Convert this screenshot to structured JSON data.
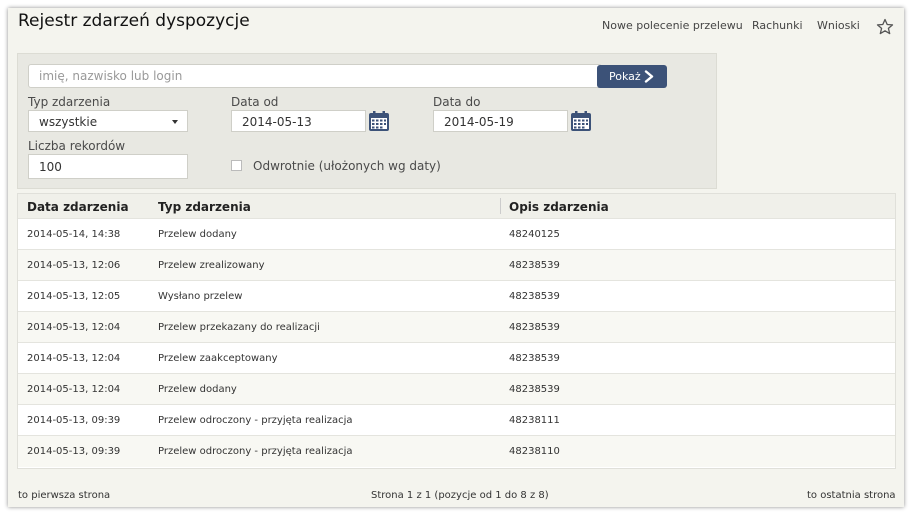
{
  "page": {
    "title": "Rejestr zdarzeń dyspozycje"
  },
  "topnav": {
    "items": [
      {
        "label": "Nowe polecenie przelewu"
      },
      {
        "label": "Rachunki"
      },
      {
        "label": "Wnioski"
      }
    ],
    "favorite_icon": "star-icon"
  },
  "filters": {
    "search_placeholder": "imię, nazwisko lub login",
    "show_button": "Pokaż",
    "event_type_label": "Typ zdarzenia",
    "event_type_value": "wszystkie",
    "date_from_label": "Data od",
    "date_from_value": "2014-05-13",
    "date_to_label": "Data do",
    "date_to_value": "2014-05-19",
    "record_count_label": "Liczba rekordów",
    "record_count_value": "100",
    "reverse_label": "Odwrotnie (ułożonych wg daty)",
    "reverse_checked": false
  },
  "table": {
    "headers": [
      "Data zdarzenia",
      "Typ zdarzenia",
      "Opis zdarzenia"
    ],
    "rows": [
      [
        "2014-05-14, 14:38",
        "Przelew dodany",
        "48240125"
      ],
      [
        "2014-05-13, 12:06",
        "Przelew zrealizowany",
        "48238539"
      ],
      [
        "2014-05-13, 12:05",
        "Wysłano przelew",
        "48238539"
      ],
      [
        "2014-05-13, 12:04",
        "Przelew przekazany do realizacji",
        "48238539"
      ],
      [
        "2014-05-13, 12:04",
        "Przelew zaakceptowany",
        "48238539"
      ],
      [
        "2014-05-13, 12:04",
        "Przelew dodany",
        "48238539"
      ],
      [
        "2014-05-13, 09:39",
        "Przelew odroczony - przyjęta realizacja",
        "48238111"
      ],
      [
        "2014-05-13, 09:39",
        "Przelew odroczony - przyjęta realizacja",
        "48238110"
      ]
    ]
  },
  "pagination": {
    "first": "to pierwsza strona",
    "info": "Strona 1 z 1 (pozycje od 1 do 8 z 8)",
    "last": "to ostatnia strona"
  },
  "colors": {
    "button_bg": "#3c5278",
    "calendar_icon": "#3c5278",
    "panel_bg": "#e8e8e2"
  }
}
